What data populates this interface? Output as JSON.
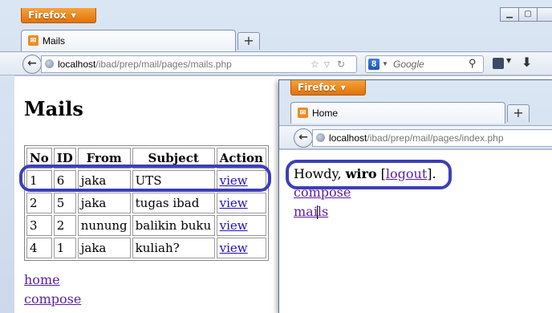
{
  "back_window": {
    "firefox_button": "Firefox",
    "tab": {
      "title": "Mails"
    },
    "url": {
      "host": "localhost",
      "path": "/ibad/prep/mail/pages/mails.php"
    },
    "search": {
      "engine_letter": "8",
      "placeholder": "Google"
    },
    "page": {
      "heading": "Mails",
      "table": {
        "headers": [
          "No",
          "ID",
          "From",
          "Subject",
          "Action"
        ],
        "rows": [
          [
            "1",
            "6",
            "jaka",
            "UTS",
            "view"
          ],
          [
            "2",
            "5",
            "jaka",
            "tugas ibad",
            "view"
          ],
          [
            "3",
            "2",
            "nunung",
            "balikin buku",
            "view"
          ],
          [
            "4",
            "1",
            "jaka",
            "kuliah?",
            "view"
          ]
        ]
      },
      "links": [
        "home",
        "compose"
      ]
    }
  },
  "front_window": {
    "firefox_button": "Firefox",
    "tab": {
      "title": "Home"
    },
    "url": {
      "host": "localhost",
      "path": "/ibad/prep/mail/pages/index.php"
    },
    "page": {
      "greeting_prefix": "Howdy,",
      "username": "wiro",
      "logout_open": "[",
      "logout_label": "logout",
      "logout_close": "].",
      "links": [
        "compose",
        "mails"
      ]
    }
  },
  "colors": {
    "highlight": "#3d3fb6",
    "firefox_orange": "#e0730a",
    "link": "#2210c0"
  }
}
